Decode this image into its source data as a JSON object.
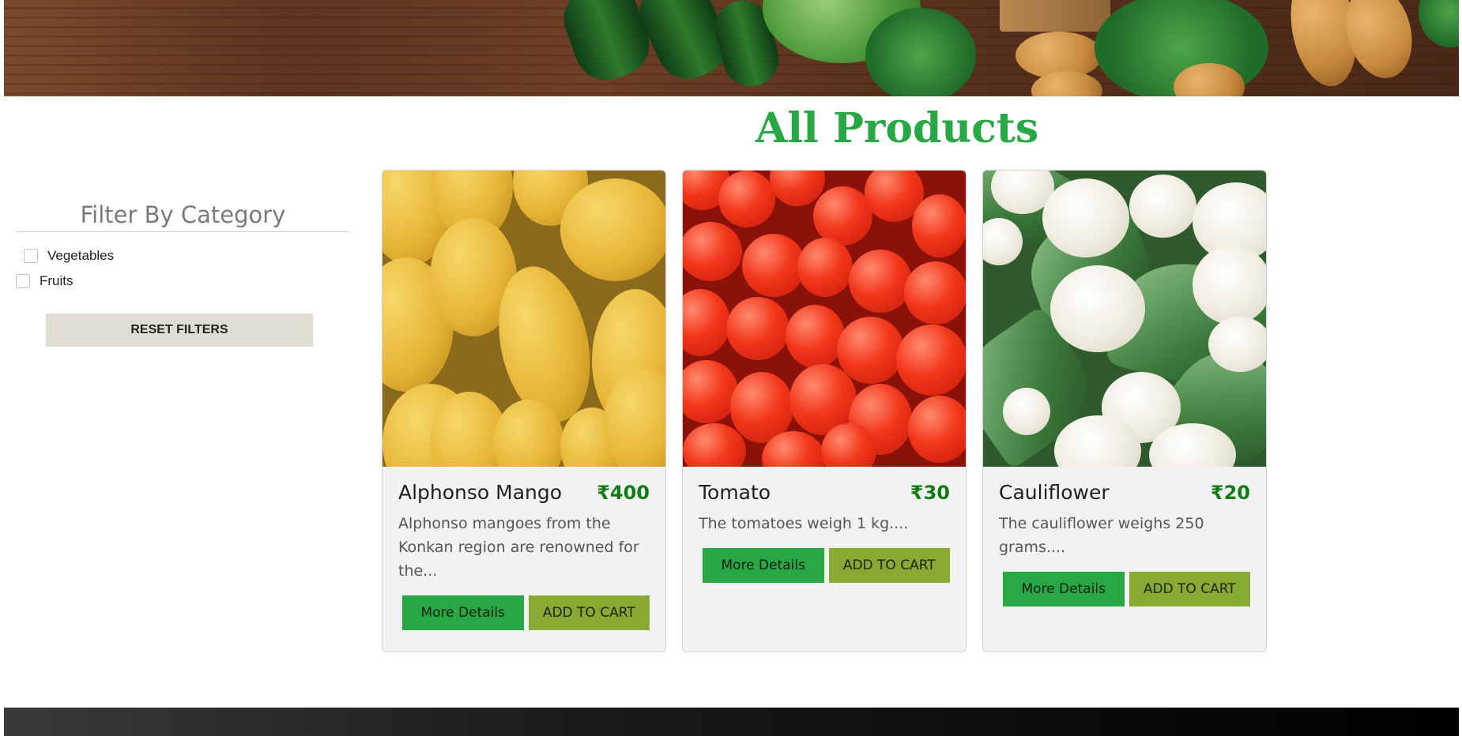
{
  "main": {
    "title": "All Products"
  },
  "sidebar": {
    "title": "Filter By Category",
    "filters": [
      {
        "label": "Vegetables",
        "checked": false
      },
      {
        "label": "Fruits",
        "checked": false
      }
    ],
    "reset_label": "RESET FILTERS"
  },
  "products": [
    {
      "name": "Alphonso Mango",
      "price": "₹400",
      "description": "Alphonso mangoes from the Konkan region are renowned for the...",
      "details_label": "More Details",
      "cart_label": "ADD TO CART"
    },
    {
      "name": "Tomato",
      "price": "₹30",
      "description": "The tomatoes weigh 1 kg....",
      "details_label": "More Details",
      "cart_label": "ADD TO CART"
    },
    {
      "name": "Cauliflower",
      "price": "₹20",
      "description": "The cauliflower weighs 250 grams....",
      "details_label": "More Details",
      "cart_label": "ADD TO CART"
    }
  ],
  "colors": {
    "accent_green": "#28a745",
    "price_green": "#0f7c14",
    "cart_olive": "#86aa32",
    "reset_beige": "#e2ddd3"
  }
}
